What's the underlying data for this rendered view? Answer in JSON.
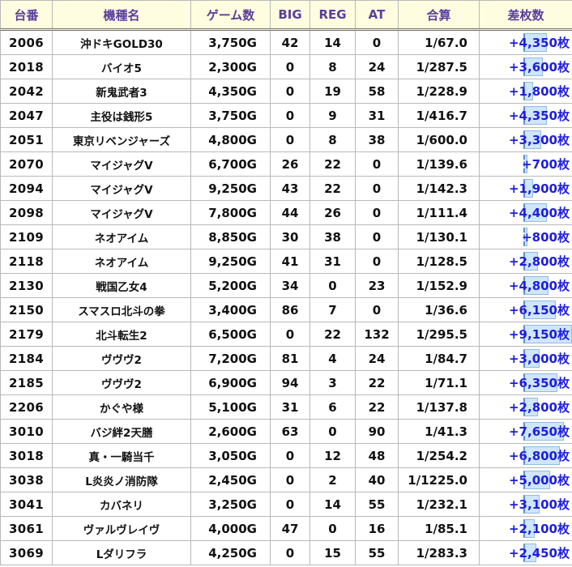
{
  "colors": {
    "header_bg": "#fffde0",
    "header_text": "#5a3e9e",
    "diff_text": "#1d1de0",
    "bar_fill": "#cfe6fb"
  },
  "headers": [
    "台番",
    "機種名",
    "ゲーム数",
    "BIG",
    "REG",
    "AT",
    "合算",
    "差枚数"
  ],
  "rows": [
    {
      "num": "2006",
      "name": "沖ドキGOLD30",
      "games": "3,750G",
      "big": "42",
      "reg": "14",
      "at": "0",
      "total": "1/67.0",
      "diff": "+4,350枚",
      "diff_value": 4350
    },
    {
      "num": "2018",
      "name": "バイオ5",
      "games": "2,300G",
      "big": "0",
      "reg": "8",
      "at": "24",
      "total": "1/287.5",
      "diff": "+3,600枚",
      "diff_value": 3600
    },
    {
      "num": "2042",
      "name": "新鬼武者3",
      "games": "4,350G",
      "big": "0",
      "reg": "19",
      "at": "58",
      "total": "1/228.9",
      "diff": "+1,800枚",
      "diff_value": 1800
    },
    {
      "num": "2047",
      "name": "主役は銭形5",
      "games": "3,750G",
      "big": "0",
      "reg": "9",
      "at": "31",
      "total": "1/416.7",
      "diff": "+4,350枚",
      "diff_value": 4350
    },
    {
      "num": "2051",
      "name": "東京リベンジャーズ",
      "games": "4,800G",
      "big": "0",
      "reg": "8",
      "at": "38",
      "total": "1/600.0",
      "diff": "+3,300枚",
      "diff_value": 3300
    },
    {
      "num": "2070",
      "name": "マイジャグV",
      "games": "6,700G",
      "big": "26",
      "reg": "22",
      "at": "0",
      "total": "1/139.6",
      "diff": "+700枚",
      "diff_value": 700
    },
    {
      "num": "2094",
      "name": "マイジャグV",
      "games": "9,250G",
      "big": "43",
      "reg": "22",
      "at": "0",
      "total": "1/142.3",
      "diff": "+1,900枚",
      "diff_value": 1900
    },
    {
      "num": "2098",
      "name": "マイジャグV",
      "games": "7,800G",
      "big": "44",
      "reg": "26",
      "at": "0",
      "total": "1/111.4",
      "diff": "+4,400枚",
      "diff_value": 4400
    },
    {
      "num": "2109",
      "name": "ネオアイム",
      "games": "8,850G",
      "big": "30",
      "reg": "38",
      "at": "0",
      "total": "1/130.1",
      "diff": "+800枚",
      "diff_value": 800
    },
    {
      "num": "2118",
      "name": "ネオアイム",
      "games": "9,250G",
      "big": "41",
      "reg": "31",
      "at": "0",
      "total": "1/128.5",
      "diff": "+2,800枚",
      "diff_value": 2800
    },
    {
      "num": "2130",
      "name": "戦国乙女4",
      "games": "5,200G",
      "big": "34",
      "reg": "0",
      "at": "23",
      "total": "1/152.9",
      "diff": "+4,800枚",
      "diff_value": 4800
    },
    {
      "num": "2150",
      "name": "スマスロ北斗の拳",
      "games": "3,400G",
      "big": "86",
      "reg": "7",
      "at": "0",
      "total": "1/36.6",
      "diff": "+6,150枚",
      "diff_value": 6150
    },
    {
      "num": "2179",
      "name": "北斗転生2",
      "games": "6,500G",
      "big": "0",
      "reg": "22",
      "at": "132",
      "total": "1/295.5",
      "diff": "+9,150枚",
      "diff_value": 9150
    },
    {
      "num": "2184",
      "name": "ヴヴヴ2",
      "games": "7,200G",
      "big": "81",
      "reg": "4",
      "at": "24",
      "total": "1/84.7",
      "diff": "+3,000枚",
      "diff_value": 3000
    },
    {
      "num": "2185",
      "name": "ヴヴヴ2",
      "games": "6,900G",
      "big": "94",
      "reg": "3",
      "at": "22",
      "total": "1/71.1",
      "diff": "+6,350枚",
      "diff_value": 6350
    },
    {
      "num": "2206",
      "name": "かぐや様",
      "games": "5,100G",
      "big": "31",
      "reg": "6",
      "at": "22",
      "total": "1/137.8",
      "diff": "+2,800枚",
      "diff_value": 2800
    },
    {
      "num": "3010",
      "name": "バジ絆2天膳",
      "games": "2,600G",
      "big": "63",
      "reg": "0",
      "at": "90",
      "total": "1/41.3",
      "diff": "+7,650枚",
      "diff_value": 7650
    },
    {
      "num": "3018",
      "name": "真・一騎当千",
      "games": "3,050G",
      "big": "0",
      "reg": "12",
      "at": "48",
      "total": "1/254.2",
      "diff": "+6,800枚",
      "diff_value": 6800
    },
    {
      "num": "3038",
      "name": "L炎炎ノ消防隊",
      "games": "2,450G",
      "big": "0",
      "reg": "2",
      "at": "40",
      "total": "1/1225.0",
      "diff": "+5,000枚",
      "diff_value": 5000
    },
    {
      "num": "3041",
      "name": "カバネリ",
      "games": "3,250G",
      "big": "0",
      "reg": "14",
      "at": "55",
      "total": "1/232.1",
      "diff": "+3,100枚",
      "diff_value": 3100
    },
    {
      "num": "3061",
      "name": "ヴァルヴレイヴ",
      "games": "4,000G",
      "big": "47",
      "reg": "0",
      "at": "16",
      "total": "1/85.1",
      "diff": "+2,100枚",
      "diff_value": 2100
    },
    {
      "num": "3069",
      "name": "Lダリフラ",
      "games": "4,250G",
      "big": "0",
      "reg": "15",
      "at": "55",
      "total": "1/283.3",
      "diff": "+2,450枚",
      "diff_value": 2450
    }
  ]
}
